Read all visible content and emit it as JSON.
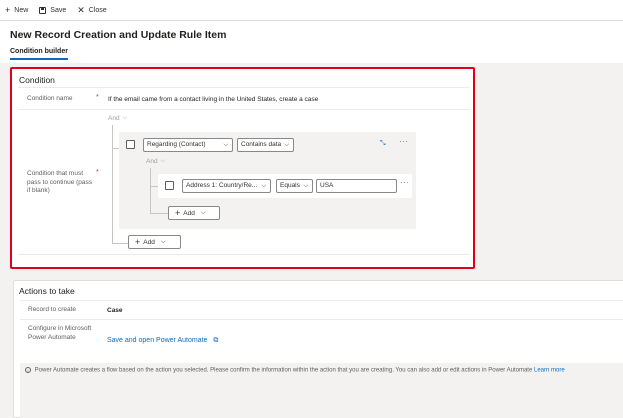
{
  "toolbar": {
    "new_label": "New",
    "save_label": "Save",
    "close_label": "Close"
  },
  "header": {
    "title": "New Record Creation and Update Rule Item",
    "tab_label": "Condition builder"
  },
  "condition": {
    "section_title": "Condition",
    "name_label": "Condition name",
    "name_value": "If the email came from a contact living in the United States, create a case",
    "must_pass_label": "Condition that must pass to continue (pass if blank)",
    "required_marker": "*",
    "outer_and": "And",
    "group": {
      "field": "Regarding (Contact)",
      "operator": "Contains data",
      "inner_and": "And",
      "row": {
        "field": "Address 1: Country/Re...",
        "operator": "Equals",
        "value": "USA"
      },
      "add_label": "Add"
    },
    "add_label": "Add"
  },
  "actions": {
    "section_title": "Actions to take",
    "record_label": "Record to create",
    "record_value": "Case",
    "configure_label": "Configure in Microsoft Power Automate",
    "power_automate_link": "Save and open Power Automate",
    "notice_text": "Power Automate creates a flow based on the action you selected. Please confirm the information within the action that you are creating. You can also add or edit actions in Power Automate",
    "learn_more": "Learn more"
  },
  "icons": {
    "new": "plus-icon",
    "save": "save-icon",
    "close": "close-icon",
    "collapse": "collapse-icon",
    "more": "more-icon",
    "chevron": "chevron-down-icon",
    "external": "external-link-icon",
    "info": "info-icon"
  },
  "colors": {
    "accent": "#0f6cbd",
    "highlight_border": "#e0001b",
    "required": "#c4314b"
  }
}
